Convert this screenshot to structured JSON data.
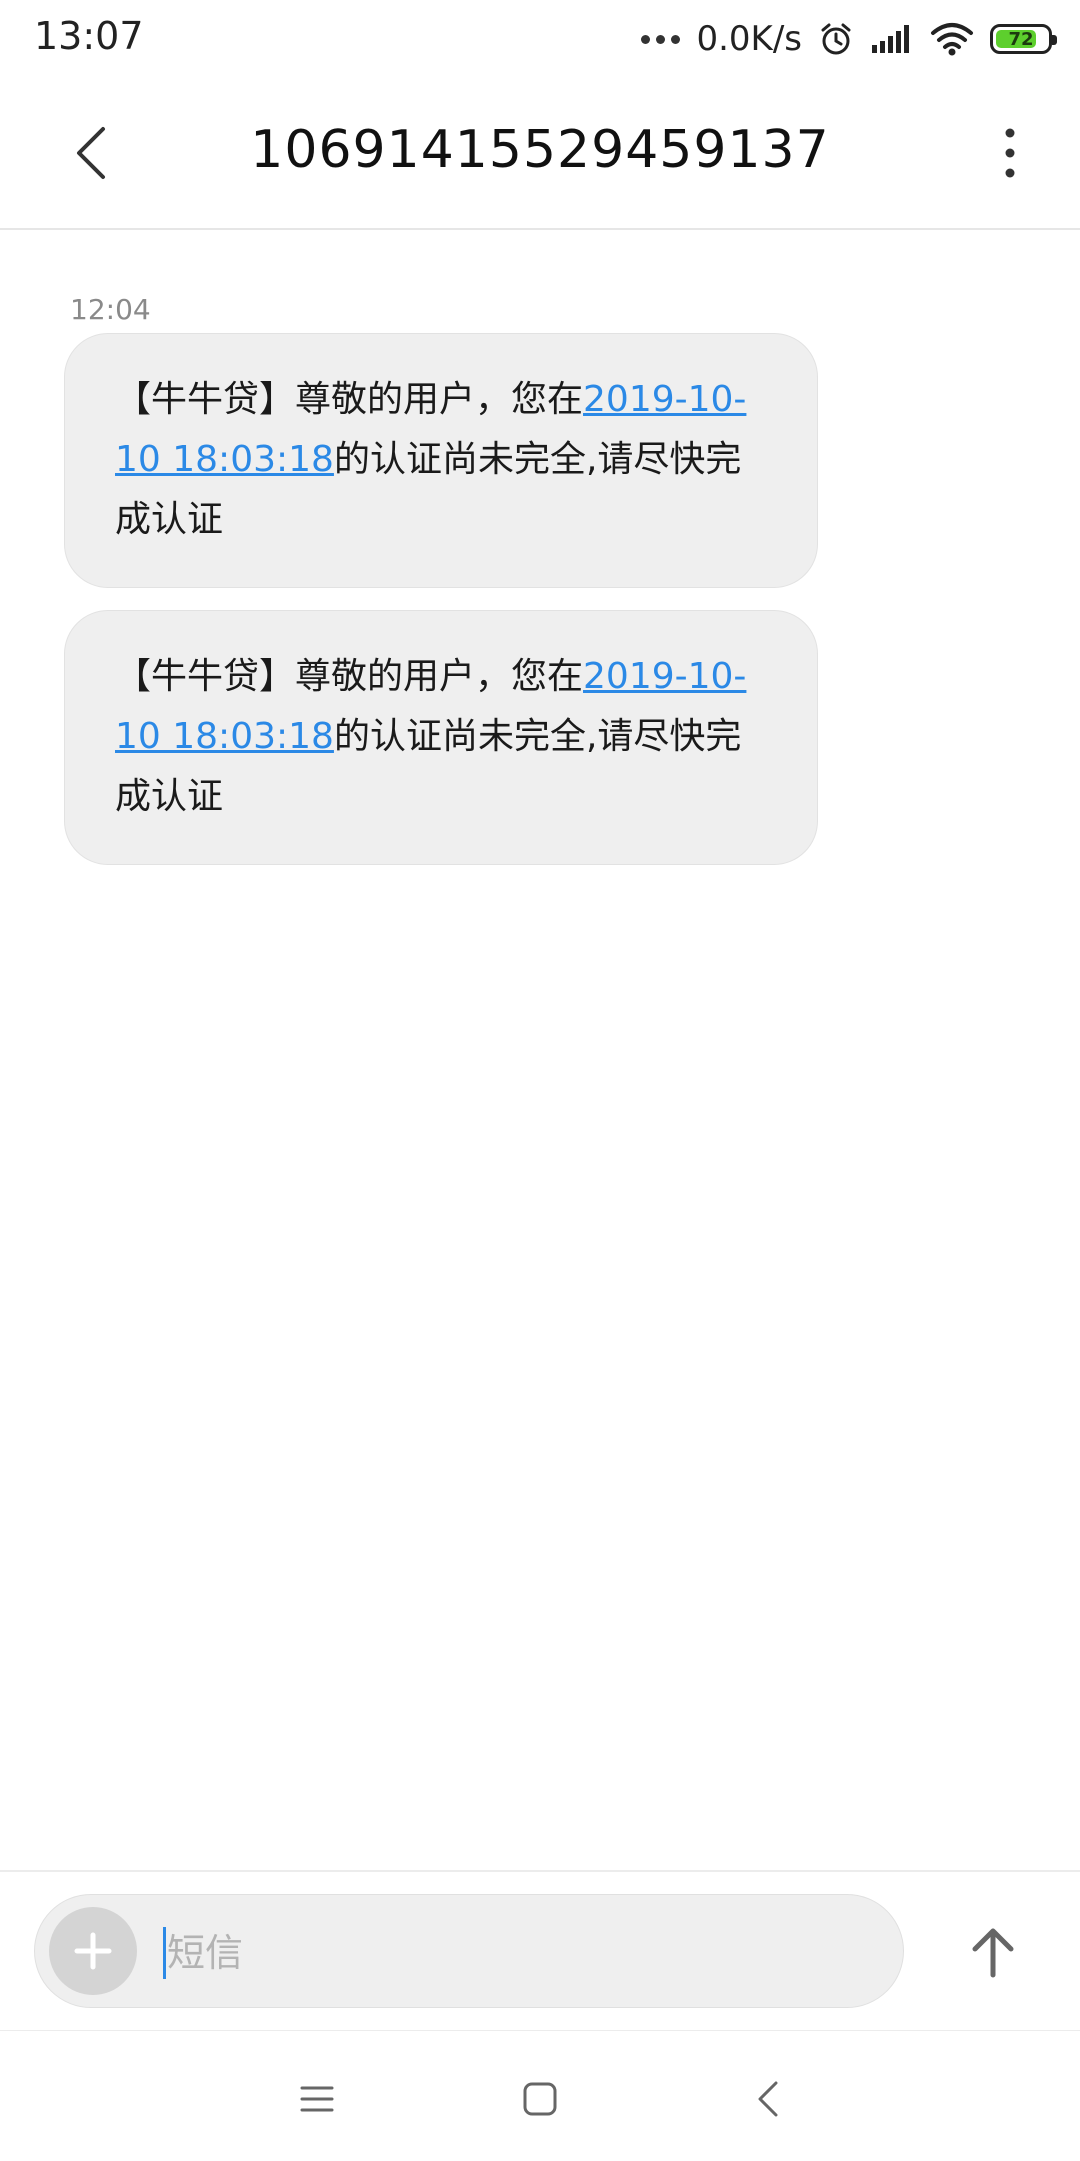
{
  "status_bar": {
    "time": "13:07",
    "net_speed": "0.0K/s",
    "battery_level": "72",
    "battery_color": "#5dcf2d",
    "icons": [
      "more-dots-icon",
      "alarm-icon",
      "signal-icon",
      "wifi-icon",
      "battery-icon"
    ]
  },
  "header": {
    "title": "10691415529459137",
    "back_icon": "chevron-left-icon",
    "more_icon": "vertical-dots-icon"
  },
  "conversation": {
    "timestamp": "12:04",
    "messages": [
      {
        "prefix": "【牛牛贷】尊敬的用户，您在",
        "link": "2019-10-10 18:03:18",
        "suffix": "的认证尚未完全,请尽快完成认证"
      },
      {
        "prefix": "【牛牛贷】尊敬的用户，您在",
        "link": "2019-10-10 18:03:18",
        "suffix": "的认证尚未完全,请尽快完成认证"
      }
    ],
    "link_color": "#2b89e6",
    "bubble_color": "#efefef"
  },
  "composer": {
    "placeholder": "短信",
    "add_icon": "plus-icon",
    "send_icon": "arrow-up-icon"
  },
  "nav_bar": {
    "icons": [
      "menu-icon",
      "home-square-icon",
      "back-chevron-icon"
    ]
  }
}
